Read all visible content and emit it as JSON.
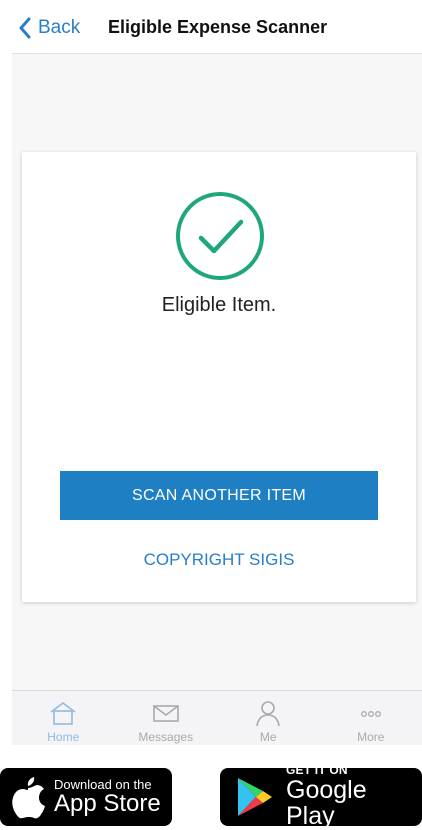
{
  "header": {
    "back_label": "Back",
    "title": "Eligible Expense Scanner"
  },
  "result": {
    "icon": "check-circle-icon",
    "status": "Eligible Item.",
    "accent_color": "#1ea77c"
  },
  "actions": {
    "scan_another_label": "SCAN ANOTHER ITEM",
    "copyright_label": "COPYRIGHT SIGIS"
  },
  "tabbar": {
    "tabs": [
      {
        "label": "Home",
        "icon": "home-icon",
        "active": true
      },
      {
        "label": "Messages",
        "icon": "envelope-icon",
        "active": false
      },
      {
        "label": "Me",
        "icon": "person-icon",
        "active": false
      },
      {
        "label": "More",
        "icon": "more-dots-icon",
        "active": false
      }
    ]
  },
  "store_badges": {
    "apple": {
      "small": "Download on the",
      "big": "App Store"
    },
    "google": {
      "small": "GET IT ON",
      "big": "Google Play"
    }
  },
  "colors": {
    "brand_blue": "#1f7fc3",
    "link_blue": "#2a7ec8",
    "check_green": "#1ea77c"
  }
}
